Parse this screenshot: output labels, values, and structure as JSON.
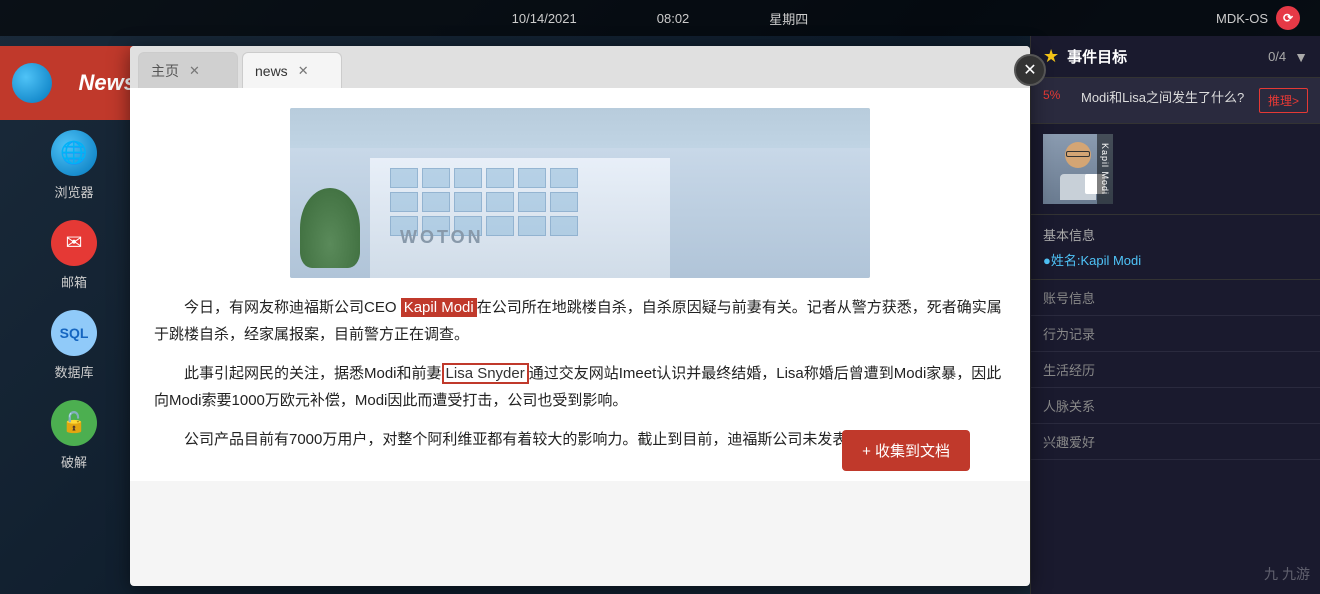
{
  "statusBar": {
    "date": "10/14/2021",
    "time": "08:02",
    "dayOfWeek": "星期四",
    "osLabel": "MDK-OS"
  },
  "taskbar": {
    "newsLabel": "News",
    "browserLabel": "浏览器",
    "mailLabel": "邮箱",
    "dbLabel": "数据库",
    "crackLabel": "破解"
  },
  "browser": {
    "tabs": [
      {
        "label": "主页",
        "active": false
      },
      {
        "label": "news",
        "active": true
      }
    ],
    "article": {
      "imageAlt": "WOTON building illustration",
      "wotонLabel": "WOTON",
      "paragraph1": "今日，有网友称迪福斯公司CEO Kapil Modi在公司所在地跳楼自杀，自杀原因疑与前妻有关。记者从警方获悉，死者确实属于跳楼自杀，经家属报案，目前警方正在调查。",
      "highlight1": "Kapil Modi",
      "paragraph2": "此事引起网民的关注，据悉Modi和前妻Lisa Snyder通过交友网站Imeet认识并最终结婚，Lisa称婚后曾遭到Modi家暴，因此向Modi索要1000万欧元补偿，Modi因此而遭受打击，公司也受到影响。",
      "highlight2": "Lisa Snyder",
      "paragraph3": "公司产品目前有7000万用户，对整个阿利维亚都有着较大的影响力。截止到目前，迪福斯公司未发表任何声明。"
    },
    "collectBtn": "+ 收集到文档"
  },
  "rightPanel": {
    "eventHeader": {
      "title": "事件目标",
      "count": "0/4"
    },
    "task": {
      "progress": "5%",
      "text": "Modi和Lisa之间发生了什么?",
      "inferBtn": "推理>"
    },
    "person": {
      "name": "Kapil Modi",
      "avatarLabel": "Kapil Modi"
    },
    "basicInfo": {
      "sectionLabel": "基本信息",
      "nameLabel": "●姓名:Kapil Modi"
    },
    "sections": [
      "账号信息",
      "行为记录",
      "生活经历",
      "人脉关系",
      "兴趣爱好"
    ]
  },
  "jiuyouWatermark": "九游"
}
